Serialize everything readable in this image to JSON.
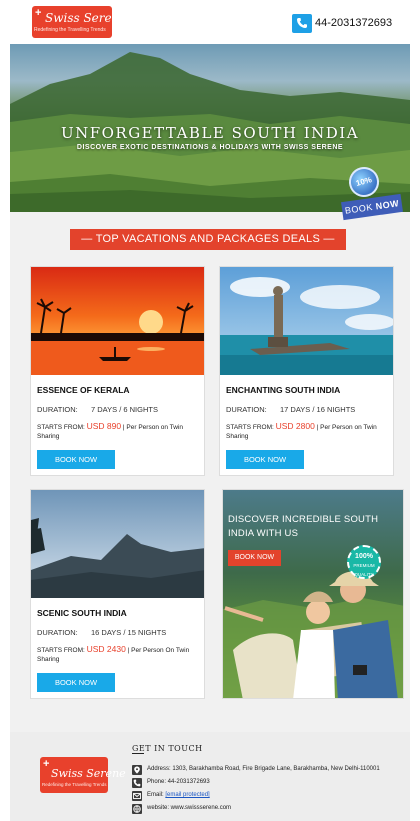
{
  "header": {
    "logo_brand": "Swiss Serene",
    "logo_tagline": "Redefining the Travelling Trends",
    "phone": "44-2031372693"
  },
  "hero": {
    "title": "UNFORGETTABLE SOUTH INDIA",
    "subtitle": "DISCOVER EXOTIC DESTINATIONS & HOLIDAYS WITH SWISS SERENE",
    "badge": "10%",
    "book_now_1": "BOOK",
    "book_now_2": "NOW"
  },
  "section_title": "— TOP VACATIONS AND PACKAGES DEALS —",
  "packages": [
    {
      "title": "ESSENCE OF KERALA",
      "duration_label": "DURATION:",
      "duration": "7 DAYS / 6 NIGHTS",
      "starts_label": "STARTS FROM:",
      "price": "USD 890",
      "price_note": "| Per Person on Twin Sharing",
      "button": "BOOK NOW"
    },
    {
      "title": "ENCHANTING SOUTH INDIA",
      "duration_label": "DURATION:",
      "duration": "17 DAYS / 16 NIGHTS",
      "starts_label": "STARTS FROM:",
      "price": "USD 2800",
      "price_note": "| Per Person on Twin Sharing",
      "button": "BOOK NOW"
    },
    {
      "title": "SCENIC SOUTH INDIA",
      "duration_label": "DURATION:",
      "duration": "16 DAYS / 15 NIGHTS",
      "starts_label": "STARTS FROM:",
      "price": "USD 2430",
      "price_note": "| Per Person On Twin Sharing",
      "button": "BOOK NOW"
    }
  ],
  "promo": {
    "title": "DISCOVER INCREDIBLE SOUTH INDIA WITH US",
    "button": "BOOK NOW",
    "quality_top": "100%",
    "quality_mid": "PREMIUM",
    "quality_bottom": "QUALITY"
  },
  "footer": {
    "heading": "GET IN TOUCH",
    "address": "Address: 1303, Barakhamba Road, Fire Brigade Lane, Barakhamba, New Delhi-110001",
    "phone": "Phone: 44-2031372693",
    "email_label": "Email:",
    "email_link": "[email protected]",
    "website": "website: www.swissserene.com"
  },
  "colors": {
    "brand_red": "#e3432c",
    "button_blue": "#19a9e8",
    "price_red": "#e8412c"
  }
}
